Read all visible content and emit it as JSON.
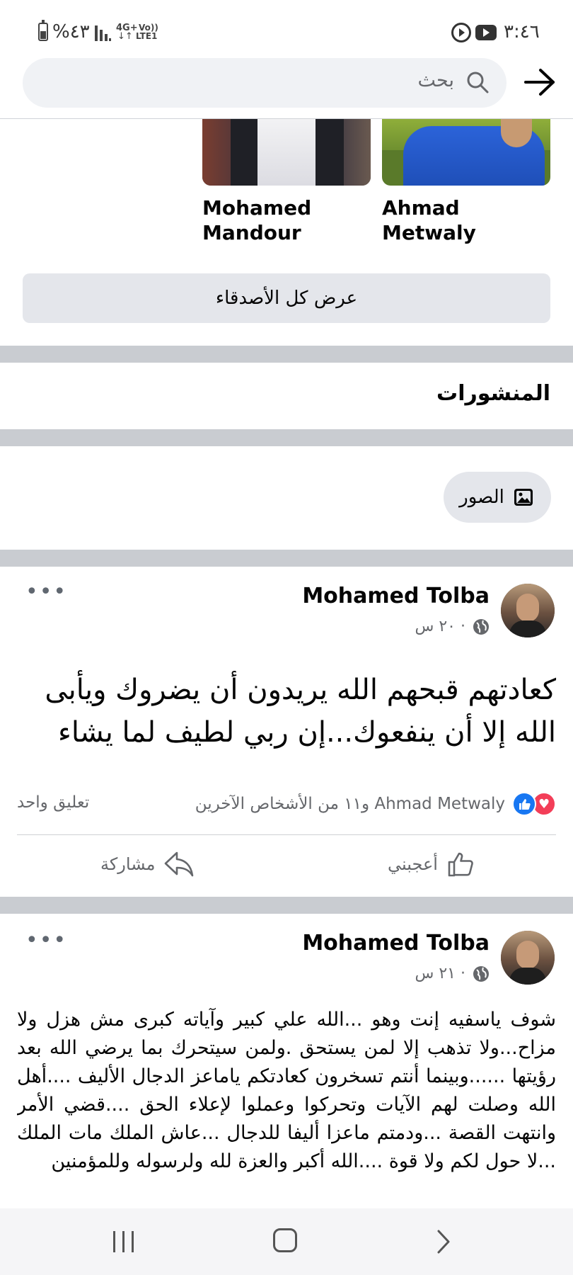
{
  "status_bar": {
    "time": "٣:٤٦",
    "battery": "%٤٣",
    "network_top": "4G+",
    "network_bottom": "↓↑",
    "volte": "Vo))",
    "lte": "LTE1"
  },
  "header": {
    "search_placeholder": "بحث"
  },
  "friends": {
    "items": [
      {
        "name_line1": "Ahmad Metwaly",
        "name_line2": ""
      },
      {
        "name_line1": "Mohamed",
        "name_line2": "Mandour"
      }
    ],
    "see_all_label": "عرض كل الأصدقاء"
  },
  "posts_section": {
    "title": "المنشورات",
    "photos_chip": "الصور"
  },
  "posts": [
    {
      "author": "Mohamed Tolba",
      "time": "٢٠ س ·",
      "text": "كعادتهم قبحهم الله يريدون أن يضروك ويأبى الله إلا أن ينفعوك...إن ربي لطيف لما يشاء",
      "reactions_text": "Ahmad Metwaly و١١ من الأشخاص الآخرين",
      "comments_text": "تعليق واحد",
      "like_label": "أعجبني",
      "share_label": "مشاركة"
    },
    {
      "author": "Mohamed Tolba",
      "time": "٢١ س ·",
      "text": "شوف ياسفيه إنت وهو ...الله علي كبير وآياته كبرى مش هزل ولا مزاح...ولا تذهب إلا لمن يستحق .ولمن سيتحرك بما يرضي الله بعد رؤيتها ......وبينما أنتم تسخرون كعادتكم ياماعز الدجال الأليف ....أهل الله وصلت لهم الآيات وتحركوا وعملوا لإعلاء الحق ....قضي الأمر وانتهت القصة ...ودمتم ماعزا أليفا للدجال ...عاش الملك مات الملك ...لا حول لكم ولا قوة ....الله أكبر والعزة لله ولرسوله وللمؤمنين"
    }
  ],
  "colors": {
    "divider": "#c9ccd1",
    "button_gray": "#e4e6eb",
    "like_blue": "#1877f2",
    "love_red": "#f33e58",
    "secondary_text": "#65676b"
  }
}
